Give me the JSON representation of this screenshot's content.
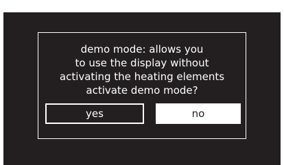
{
  "dialog": {
    "message_lines": [
      "demo mode: allows you",
      "to use the display without",
      "activating the heating elements",
      "activate demo mode?"
    ],
    "yes_label": "yes",
    "no_label": "no"
  },
  "colors": {
    "background": "#231f20",
    "foreground": "#ffffff",
    "selected_button_fill": "#ffffff"
  }
}
